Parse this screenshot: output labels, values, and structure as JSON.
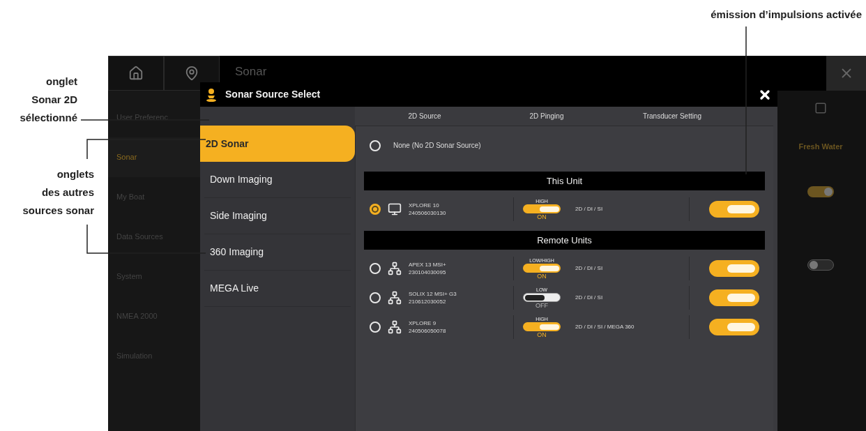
{
  "callouts": {
    "top": "émission d’impulsions activée",
    "left": [
      {
        "text": "onglet\nSonar 2D\nsélectionné"
      },
      {
        "text": "onglets\ndes autres\nsources sonar"
      }
    ]
  },
  "screen": {
    "title": "Sonar",
    "menu": [
      {
        "label": "User Preferenc",
        "selected": false
      },
      {
        "label": "Sonar",
        "selected": true
      },
      {
        "label": "My Boat",
        "selected": false
      },
      {
        "label": "Data Sources",
        "selected": false
      },
      {
        "label": "System",
        "selected": false
      },
      {
        "label": "NMEA 2000",
        "selected": false
      },
      {
        "label": "Simulation",
        "selected": false
      }
    ],
    "water_type": "Fresh Water",
    "toggles": [
      {
        "on": true
      },
      {
        "on": false
      }
    ]
  },
  "dialog": {
    "title": "Sonar Source Select",
    "columns": [
      "2D Source",
      "2D Pinging",
      "Transducer Setting"
    ],
    "tabs": [
      {
        "label": "2D Sonar",
        "selected": true
      },
      {
        "label": "Down Imaging",
        "selected": false
      },
      {
        "label": "Side Imaging",
        "selected": false
      },
      {
        "label": "360 Imaging",
        "selected": false
      },
      {
        "label": "MEGA Live",
        "selected": false
      }
    ],
    "none_option": {
      "label": "None (No 2D Sonar Source)",
      "selected": false
    },
    "sections": [
      {
        "title": "This Unit",
        "units": [
          {
            "kind": "local",
            "model": "XPLORE 10",
            "serial": "240506030130",
            "selected": true,
            "ping_mode": "HIGH",
            "ping_on": true,
            "ping_state": "ON",
            "types": "2D / DI / SI",
            "transducer_on": true
          }
        ]
      },
      {
        "title": "Remote Units",
        "units": [
          {
            "kind": "network",
            "model": "APEX 13 MSI+",
            "serial": "230104030095",
            "selected": false,
            "ping_mode": "LOW/HIGH",
            "ping_on": true,
            "ping_state": "ON",
            "types": "2D / DI / SI",
            "transducer_on": true
          },
          {
            "kind": "network",
            "model": "SOLIX 12 MSI+ G3",
            "serial": "210612030052",
            "selected": false,
            "ping_mode": "LOW",
            "ping_on": false,
            "ping_state": "OFF",
            "types": "2D / DI / SI",
            "transducer_on": true
          },
          {
            "kind": "network",
            "model": "XPLORE 9",
            "serial": "240506050078",
            "selected": false,
            "ping_mode": "HIGH",
            "ping_on": true,
            "ping_state": "ON",
            "types": "2D / DI / SI / MEGA 360",
            "transducer_on": true
          }
        ]
      }
    ]
  }
}
